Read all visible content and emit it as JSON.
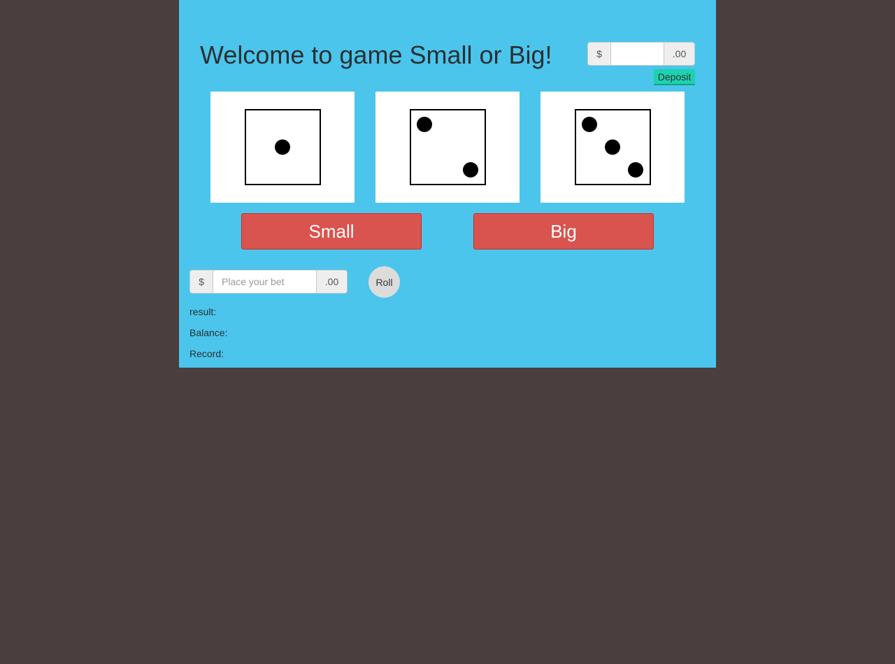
{
  "header": {
    "title": "Welcome to game Small or Big!"
  },
  "deposit": {
    "currency_symbol": "$",
    "value": "",
    "placeholder": "",
    "cents_suffix": ".00",
    "button_label": "Deposit"
  },
  "dice": [
    {
      "face": 1
    },
    {
      "face": 2
    },
    {
      "face": 3
    }
  ],
  "choices": {
    "small_label": "Small",
    "big_label": "Big"
  },
  "bet": {
    "currency_symbol": "$",
    "value": "",
    "placeholder": "Place your bet",
    "cents_suffix": ".00",
    "roll_label": "Roll"
  },
  "info": {
    "result_label": "result:",
    "balance_label": "Balance:",
    "record_label": "Record:"
  },
  "colors": {
    "page_background": "#4a3e3e",
    "panel_background": "#4bc5ec",
    "choice_button": "#d9534f",
    "deposit_button": "#1dd2af",
    "roll_button": "#dcdcdc"
  }
}
